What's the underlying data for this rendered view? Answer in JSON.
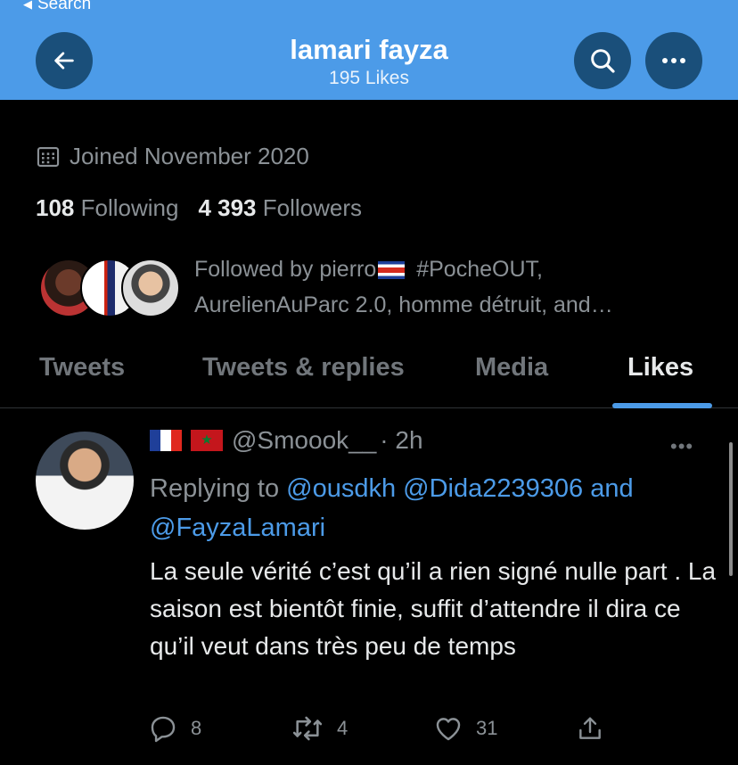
{
  "status_bar": {
    "back_label": "Search"
  },
  "header": {
    "title": "lamari fayza",
    "subtitle": "195 Likes",
    "back_icon": "arrow-left-icon",
    "search_icon": "search-icon",
    "more_icon": "more-horizontal-icon"
  },
  "profile": {
    "handle_partial": "@FayzaLamari",
    "joined": "Joined November 2020",
    "following_count": "108",
    "following_label": "Following",
    "followers_count": "4 393",
    "followers_label": "Followers",
    "followed_by_prefix": "Followed by pierro",
    "followed_by_rest": " #PocheOUT,",
    "followed_by_line2": "AurelienAuParc 2.0, homme détruit, and…"
  },
  "tabs": [
    {
      "label": "Tweets"
    },
    {
      "label": "Tweets & replies"
    },
    {
      "label": "Media"
    },
    {
      "label": "Likes"
    }
  ],
  "active_tab": "Likes",
  "tweet": {
    "username": "@Smoook__",
    "time": "· 2h",
    "replying_prefix": "Replying to",
    "mention1": "@ousdkh",
    "mention2": "@Dida2239306",
    "and_word": "and",
    "mention3": "@FayzaLamari",
    "text": "La seule vérité c’est qu’il a rien signé nulle part . La saison est bientôt finie, suffit d’attendre il dira ce qu’il veut dans très peu de temps",
    "replies": "8",
    "retweets": "4",
    "likes": "31"
  },
  "colors": {
    "accent": "#4c9be8",
    "background": "#000000",
    "header": "#4c9be8",
    "muted": "#8b9196"
  }
}
